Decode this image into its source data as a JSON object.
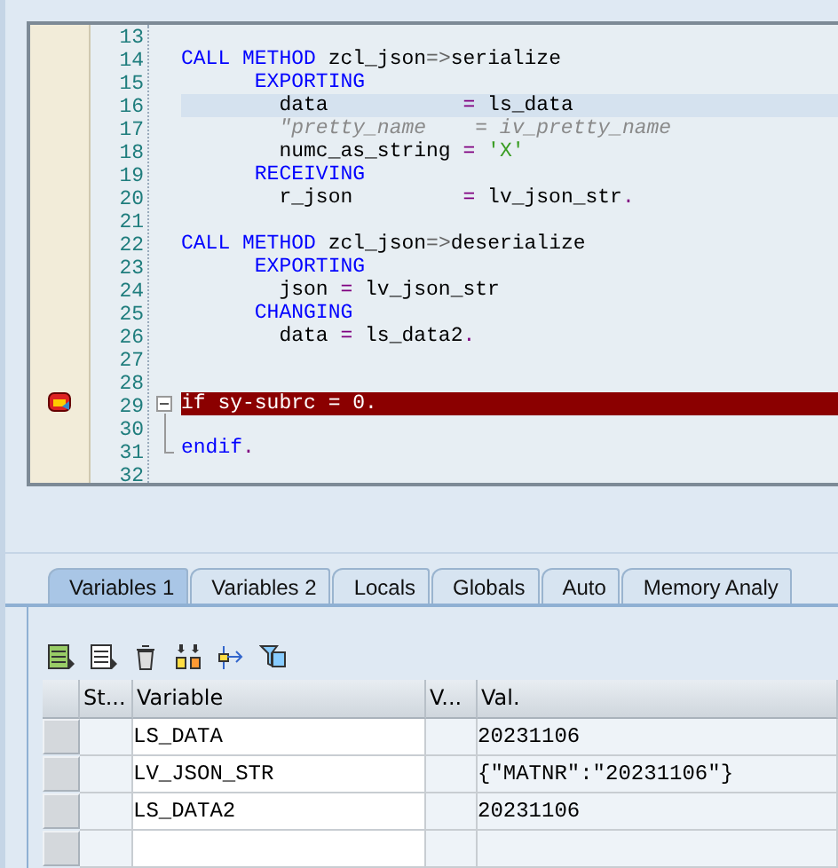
{
  "editor": {
    "lines": [
      {
        "number": "13"
      },
      {
        "number": "14",
        "tokens": [
          {
            "kind": "kw",
            "text": "CALL METHOD"
          },
          {
            "kind": "plain",
            "text": " zcl_json"
          },
          {
            "kind": "arrow",
            "text": "=>"
          },
          {
            "kind": "plain",
            "text": "serialize"
          }
        ]
      },
      {
        "number": "15",
        "tokens": [
          {
            "kind": "kw",
            "text": "      EXPORTING"
          }
        ]
      },
      {
        "number": "16",
        "cursor_line": true,
        "tokens": [
          {
            "kind": "plain",
            "text": "        data           "
          },
          {
            "kind": "op",
            "text": "="
          },
          {
            "kind": "plain",
            "text": " ls_data"
          }
        ]
      },
      {
        "number": "17",
        "tokens": [
          {
            "kind": "comment",
            "text": "        \"pretty_name    = iv_pretty_name"
          }
        ]
      },
      {
        "number": "18",
        "tokens": [
          {
            "kind": "plain",
            "text": "        numc_as_string "
          },
          {
            "kind": "op",
            "text": "="
          },
          {
            "kind": "str",
            "text": " 'X'"
          }
        ]
      },
      {
        "number": "19",
        "tokens": [
          {
            "kind": "kw",
            "text": "      RECEIVING"
          }
        ]
      },
      {
        "number": "20",
        "tokens": [
          {
            "kind": "plain",
            "text": "        r_json         "
          },
          {
            "kind": "op",
            "text": "="
          },
          {
            "kind": "plain",
            "text": " lv_json_str"
          },
          {
            "kind": "op",
            "text": "."
          }
        ]
      },
      {
        "number": "21"
      },
      {
        "number": "22",
        "tokens": [
          {
            "kind": "kw",
            "text": "CALL METHOD"
          },
          {
            "kind": "plain",
            "text": " zcl_json"
          },
          {
            "kind": "arrow",
            "text": "=>"
          },
          {
            "kind": "plain",
            "text": "deserialize"
          }
        ]
      },
      {
        "number": "23",
        "tokens": [
          {
            "kind": "kw",
            "text": "      EXPORTING"
          }
        ]
      },
      {
        "number": "24",
        "tokens": [
          {
            "kind": "plain",
            "text": "        json "
          },
          {
            "kind": "op",
            "text": "="
          },
          {
            "kind": "plain",
            "text": " lv_json_str"
          }
        ]
      },
      {
        "number": "25",
        "tokens": [
          {
            "kind": "kw",
            "text": "      CHANGING"
          }
        ]
      },
      {
        "number": "26",
        "tokens": [
          {
            "kind": "plain",
            "text": "        data "
          },
          {
            "kind": "op",
            "text": "="
          },
          {
            "kind": "plain",
            "text": " ls_data2"
          },
          {
            "kind": "op",
            "text": "."
          }
        ]
      },
      {
        "number": "27"
      },
      {
        "number": "28"
      },
      {
        "number": "29",
        "stopped": true,
        "breakpoint": true,
        "fold_start": true,
        "tokens": [
          {
            "kind": "plain",
            "text": "if sy-subrc = 0."
          }
        ]
      },
      {
        "number": "30",
        "fold_line": true
      },
      {
        "number": "31",
        "fold_end": true,
        "tokens": [
          {
            "kind": "kw",
            "text": "endif"
          },
          {
            "kind": "op",
            "text": "."
          }
        ]
      },
      {
        "number": "32"
      }
    ]
  },
  "tabs": [
    {
      "label": "Variables 1",
      "selected": true
    },
    {
      "label": "Variables 2",
      "selected": false
    },
    {
      "label": "Locals",
      "selected": false
    },
    {
      "label": "Globals",
      "selected": false
    },
    {
      "label": "Auto",
      "selected": false
    },
    {
      "label": "Memory Analy",
      "selected": false
    }
  ],
  "table": {
    "columns": [
      "St...",
      "Variable",
      "V...",
      "Val."
    ],
    "rows": [
      {
        "cells": [
          "",
          "LS_DATA",
          "",
          "20231106"
        ]
      },
      {
        "cells": [
          "",
          "LV_JSON_STR",
          "",
          "{\"MATNR\":\"20231106\"}"
        ]
      },
      {
        "cells": [
          "",
          "LS_DATA2",
          "",
          "20231106"
        ]
      },
      {
        "cells": [
          "",
          "",
          "",
          ""
        ]
      }
    ]
  }
}
